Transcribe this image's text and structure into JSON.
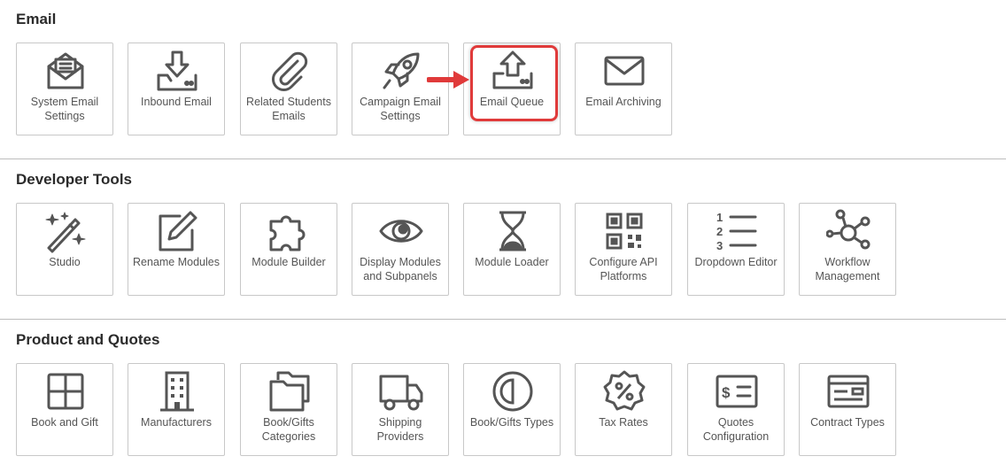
{
  "sections": [
    {
      "title": "Email",
      "tiles": [
        {
          "label": "System Email Settings",
          "icon": "open-envelope-icon"
        },
        {
          "label": "Inbound Email",
          "icon": "inbox-download-icon"
        },
        {
          "label": "Related Students Emails",
          "icon": "paperclip-icon"
        },
        {
          "label": "Campaign Email Settings",
          "icon": "rocket-icon"
        },
        {
          "label": "Email Queue",
          "icon": "upload-tray-icon"
        },
        {
          "label": "Email Archiving",
          "icon": "envelope-icon"
        }
      ]
    },
    {
      "title": "Developer Tools",
      "tiles": [
        {
          "label": "Studio",
          "icon": "magic-wand-icon"
        },
        {
          "label": "Rename Modules",
          "icon": "edit-pencil-icon"
        },
        {
          "label": "Module Builder",
          "icon": "puzzle-icon"
        },
        {
          "label": "Display Modules and Subpanels",
          "icon": "eye-icon"
        },
        {
          "label": "Module Loader",
          "icon": "hourglass-icon"
        },
        {
          "label": "Configure API Platforms",
          "icon": "qr-code-icon"
        },
        {
          "label": "Dropdown Editor",
          "icon": "numbered-list-icon"
        },
        {
          "label": "Workflow Management",
          "icon": "network-nodes-icon"
        }
      ]
    },
    {
      "title": "Product and Quotes",
      "tiles": [
        {
          "label": "Book and Gift",
          "icon": "grid-box-icon"
        },
        {
          "label": "Manufacturers",
          "icon": "building-icon"
        },
        {
          "label": "Book/Gifts Categories",
          "icon": "folders-icon"
        },
        {
          "label": "Shipping Providers",
          "icon": "truck-icon"
        },
        {
          "label": "Book/Gifts Types",
          "icon": "half-circle-icon"
        },
        {
          "label": "Tax Rates",
          "icon": "percent-badge-icon"
        },
        {
          "label": "Quotes Configuration",
          "icon": "price-tag-icon"
        },
        {
          "label": "Contract Types",
          "icon": "contract-card-icon"
        }
      ]
    }
  ],
  "annotation": {
    "highlighted_tile": "Email Queue",
    "accent_color": "#e03a3a"
  },
  "colors": {
    "icon_stroke": "#555555",
    "tile_border": "#c8c8c8",
    "divider": "#bdbdbd"
  }
}
